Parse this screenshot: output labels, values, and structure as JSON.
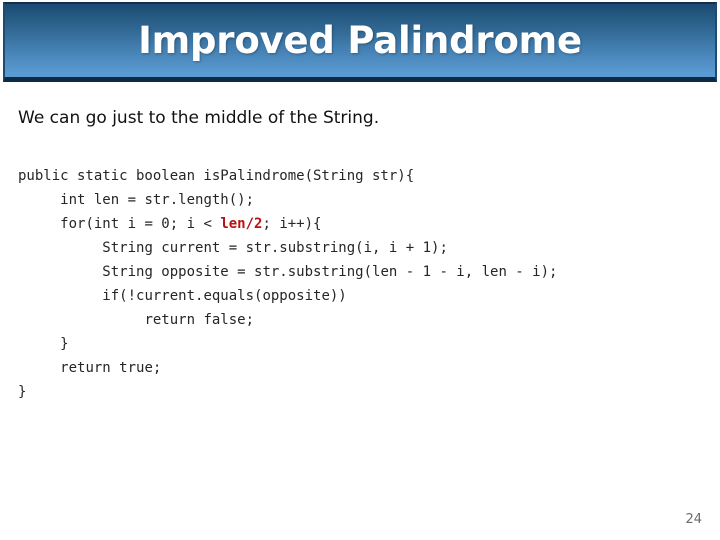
{
  "slide": {
    "title": "Improved Palindrome",
    "body_text": "We can go just to the middle of the String.",
    "slide_number": "24",
    "colors": {
      "banner_gradient_top": "#1b4a73",
      "banner_gradient_bottom": "#5b9bd5",
      "banner_border": "#0d2b44",
      "title_color": "#ffffff",
      "body_color": "#111111",
      "code_color": "#262626",
      "highlight_color": "#b81212",
      "slide_number_color": "#6b6b6b",
      "background": "#ffffff"
    }
  },
  "code": {
    "language": "java",
    "lines": [
      {
        "indent": 0,
        "segments": [
          {
            "text": "public static boolean isPalindrome(String str){",
            "style": "plain"
          }
        ]
      },
      {
        "indent": 1,
        "segments": [
          {
            "text": "int len = str.length();",
            "style": "plain"
          }
        ]
      },
      {
        "indent": 1,
        "segments": [
          {
            "text": "for(int i = 0; i < ",
            "style": "plain"
          },
          {
            "text": "len/2",
            "style": "highlight"
          },
          {
            "text": "; i++){",
            "style": "plain"
          }
        ]
      },
      {
        "indent": 2,
        "segments": [
          {
            "text": "String current = str.substring(i, i + 1);",
            "style": "plain"
          }
        ]
      },
      {
        "indent": 2,
        "segments": [
          {
            "text": "String opposite = str.substring(len - 1 - i, len - i);",
            "style": "plain"
          }
        ]
      },
      {
        "indent": 2,
        "segments": [
          {
            "text": "if(!current.equals(opposite))",
            "style": "plain"
          }
        ]
      },
      {
        "indent": 3,
        "segments": [
          {
            "text": "return false;",
            "style": "plain"
          }
        ]
      },
      {
        "indent": 1,
        "segments": [
          {
            "text": "}",
            "style": "plain"
          }
        ]
      },
      {
        "indent": 1,
        "segments": [
          {
            "text": "return true;",
            "style": "plain"
          }
        ]
      },
      {
        "indent": 0,
        "segments": [
          {
            "text": "}",
            "style": "plain"
          }
        ]
      }
    ],
    "indent_unit_spaces": 5
  }
}
